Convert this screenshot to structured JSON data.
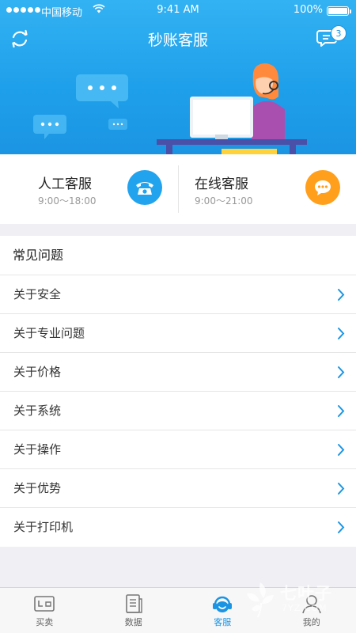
{
  "status_bar": {
    "carrier": "中国移动",
    "time": "9:41 AM",
    "battery": "100%"
  },
  "nav": {
    "title": "秒账客服",
    "message_badge": "3"
  },
  "services": [
    {
      "title": "人工客服",
      "hours": "9:00～18:00",
      "icon": "phone-icon",
      "color": "#22a3ee"
    },
    {
      "title": "在线客服",
      "hours": "9:00～21:00",
      "icon": "chat-icon",
      "color": "#ff9f1c"
    }
  ],
  "faq": {
    "title": "常见问题",
    "items": [
      "关于安全",
      "关于专业问题",
      "关于价格",
      "关于系统",
      "关于操作",
      "关于优势",
      "关于打印机"
    ]
  },
  "tabs": [
    {
      "label": "买卖",
      "icon": "trade-icon",
      "active": false
    },
    {
      "label": "数据",
      "icon": "data-icon",
      "active": false
    },
    {
      "label": "客服",
      "icon": "service-icon",
      "active": true
    },
    {
      "label": "我的",
      "icon": "profile-icon",
      "active": false
    }
  ],
  "watermark": {
    "text": "七叶子",
    "sub": "7YZ.COM"
  },
  "colors": {
    "primary": "#1b95e3",
    "accent_orange": "#ff9f1c"
  }
}
